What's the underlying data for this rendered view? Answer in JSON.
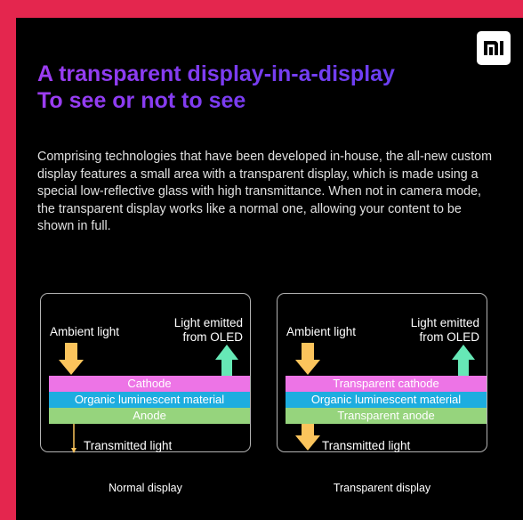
{
  "brand": {
    "logo_text": "mi"
  },
  "heading": {
    "line1": "A transparent display-in-a-display",
    "line2": "To see or not to see"
  },
  "description": "Comprising technologies that have been developed in-house, the all-new custom display features a small area with a transparent display, which is made using a special low-reflective glass with high transmittance. When not in camera mode, the transparent display works like a normal one, allowing your content to be shown in full.",
  "diagrams": [
    {
      "ambient_label": "Ambient light",
      "emitted_line1": "Light emitted",
      "emitted_line2": "from OLED",
      "layers": [
        "Cathode",
        "Organic luminescent material",
        "Anode"
      ],
      "transmitted_label": "Transmitted light",
      "caption": "Normal display"
    },
    {
      "ambient_label": "Ambient light",
      "emitted_line1": "Light emitted",
      "emitted_line2": "from OLED",
      "layers": [
        "Transparent cathode",
        "Organic luminescent material",
        "Transparent anode"
      ],
      "transmitted_label": "Transmitted light",
      "caption": "Transparent display"
    }
  ],
  "colors": {
    "background_accent": "#e4264e",
    "cathode_layer": "#ed74e6",
    "organic_layer": "#1dade0",
    "anode_layer": "#96d47d",
    "ambient_arrow": "#fbc45c",
    "emitted_arrow": "#66e8b6"
  }
}
